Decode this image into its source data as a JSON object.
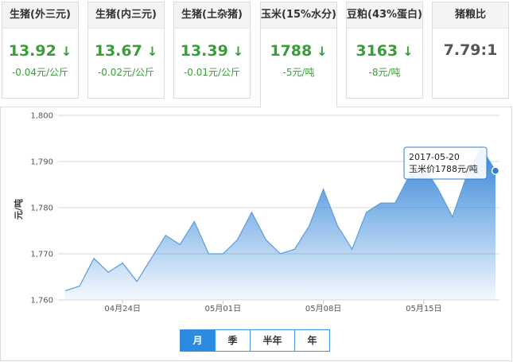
{
  "cards": [
    {
      "title": "生猪(外三元)",
      "price": "13.92",
      "arrow": "↓",
      "change": "-0.04元/公斤"
    },
    {
      "title": "生猪(内三元)",
      "price": "13.67",
      "arrow": "↓",
      "change": "-0.02元/公斤"
    },
    {
      "title": "生猪(土杂猪)",
      "price": "13.39",
      "arrow": "↓",
      "change": "-0.01元/公斤"
    },
    {
      "title": "玉米(15%水分)",
      "price": "1788",
      "arrow": "↓",
      "change": "-5元/吨"
    },
    {
      "title": "豆粕(43%蛋白)",
      "price": "3163",
      "arrow": "↓",
      "change": "-8元/吨"
    },
    {
      "title": "猪粮比",
      "ratio": "7.79:1"
    }
  ],
  "colors": {
    "up_down_green": "#3a9d3a",
    "area_fill": "#2a7fd6",
    "line": "#5b9be0",
    "tab_active": "#2b8be0"
  },
  "tooltip": {
    "date": "2017-05-20",
    "label": "玉米价1788元/吨"
  },
  "tabs": [
    {
      "label": "月",
      "active": true
    },
    {
      "label": "季",
      "active": false
    },
    {
      "label": "半年",
      "active": false
    },
    {
      "label": "年",
      "active": false
    }
  ],
  "chart_data": {
    "type": "area",
    "title": "",
    "ylabel": "元/吨",
    "xlabel": "",
    "ylim": [
      1760,
      1800
    ],
    "yticks": [
      "1,760",
      "1,770",
      "1,780",
      "1,790",
      "1,800"
    ],
    "xtick_labels": [
      "04月24日",
      "05月01日",
      "05月08日",
      "05月15日"
    ],
    "grid": true,
    "series": [
      {
        "x": [
          "04-20",
          "04-21",
          "04-22",
          "04-23",
          "04-24",
          "04-25",
          "04-26",
          "04-27",
          "04-28",
          "04-29",
          "04-30",
          "05-01",
          "05-02",
          "05-03",
          "05-04",
          "05-05",
          "05-06",
          "05-07",
          "05-08",
          "05-09",
          "05-10",
          "05-11",
          "05-12",
          "05-13",
          "05-14",
          "05-15",
          "05-16",
          "05-17",
          "05-18",
          "05-19",
          "05-20"
        ],
        "values": [
          1762,
          1763,
          1769,
          1766,
          1768,
          1764,
          1769,
          1774,
          1772,
          1777,
          1770,
          1770,
          1773,
          1779,
          1773,
          1770,
          1771,
          1776,
          1784,
          1776,
          1771,
          1779,
          1781,
          1781,
          1787,
          1789,
          1784,
          1778,
          1787,
          1793,
          1788
        ]
      }
    ]
  }
}
